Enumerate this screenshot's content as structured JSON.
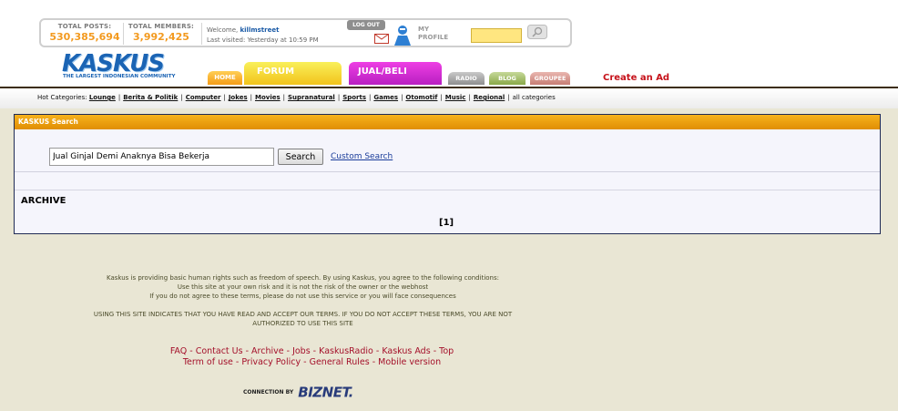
{
  "header": {
    "total_posts_label": "TOTAL POSTS:",
    "total_posts_value": "530,385,694",
    "total_members_label": "TOTAL MEMBERS:",
    "total_members_value": "3,992,425",
    "welcome_prefix": "Welcome,",
    "username": "killmstreet",
    "last_visited": "Last visited: Yesterday at 10:59 PM",
    "logout_label": "LOG OUT",
    "profile_label_1": "MY",
    "profile_label_2": "PROFILE",
    "logo_text": "KASKUS",
    "logo_tagline": "THE LARGEST INDONESIAN COMMUNITY",
    "tabs": {
      "home": "HOME",
      "forum": "FORUM",
      "jual_beli": "JUAL/BELI",
      "radio": "RADIO",
      "blog": "BLOG",
      "groupee": "GROUPEE"
    },
    "create_ad": "Create an Ad"
  },
  "hotbar": {
    "label": "Hot Categories:",
    "categories": [
      "Lounge",
      "Berita & Politik",
      "Computer",
      "Jokes",
      "Movies",
      "Supranatural",
      "Sports",
      "Games",
      "Otomotif",
      "Music",
      "Regional"
    ],
    "all_label": "all categories"
  },
  "search": {
    "panel_title": "KASKUS Search",
    "query": "Jual Ginjal Demi Anaknya Bisa Bekerja",
    "button_label": "Search",
    "custom_search": "Custom Search",
    "archive_label": "ARCHIVE",
    "page_link": "[1]"
  },
  "footer": {
    "terms_line1": "Kaskus is providing basic human rights such as freedom of speech. By using Kaskus, you agree to the following conditions:",
    "terms_line2": "Use this site at your own risk and it is not the risk of the owner or the webhost",
    "terms_line3": "If you do not agree to these terms, please do not use this service or you will face consequences",
    "accept_line1": "USING THIS SITE INDICATES THAT YOU HAVE READ AND ACCEPT OUR TERMS. IF YOU DO NOT ACCEPT THESE TERMS, YOU ARE NOT",
    "accept_line2": "AUTHORIZED TO USE THIS SITE",
    "links_row1": [
      "FAQ",
      "Contact Us",
      "Archive",
      "Jobs",
      "KaskusRadio",
      "Kaskus Ads",
      "Top"
    ],
    "links_row2": [
      "Term of use",
      "Privacy Policy",
      "General Rules",
      "Mobile version"
    ],
    "connection_by": "CONNECTION BY",
    "biznet": "BIZNET."
  },
  "colors": {
    "accent_orange": "#f39a1f",
    "panel_title": "#e08e04",
    "link_red": "#a4102a",
    "create_ad_red": "#c6121a",
    "background": "#e9e6d4"
  }
}
